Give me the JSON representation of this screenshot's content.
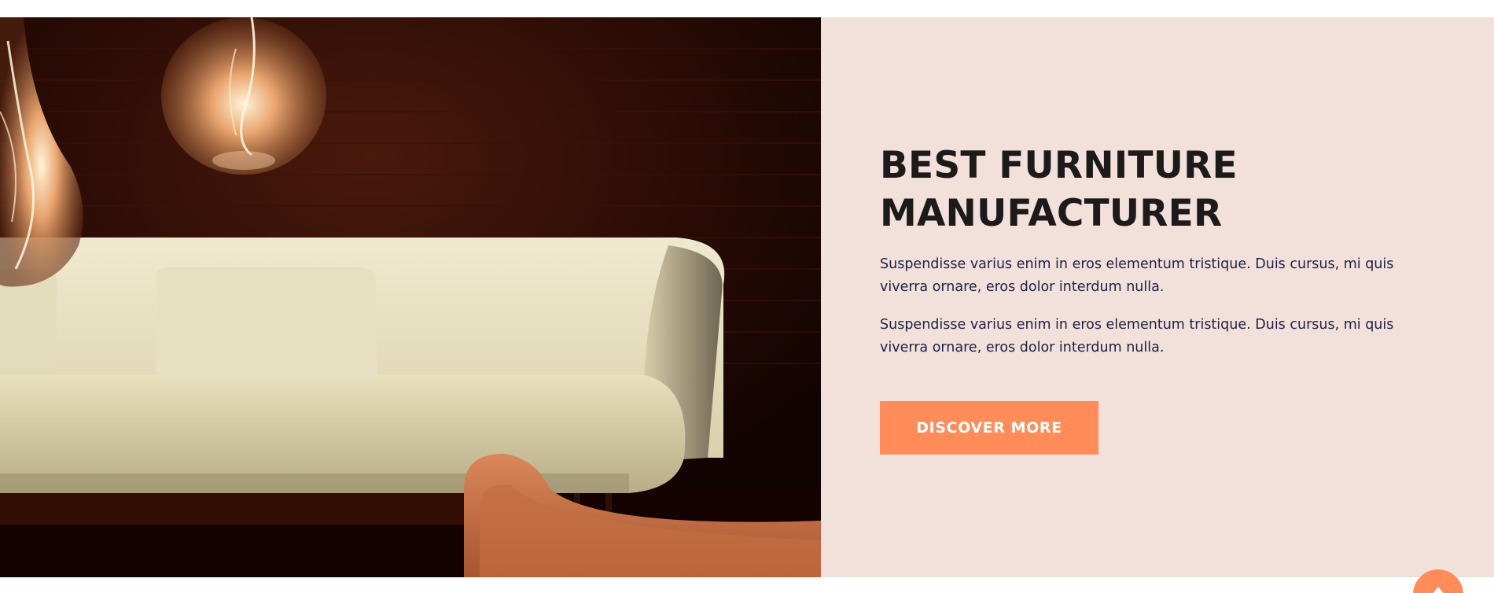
{
  "hero": {
    "image": {
      "description": "sofa-and-hanging-bulbs-photo"
    },
    "headline_line1": "BEST FURNITURE",
    "headline_line2": "MANUFACTURER",
    "paragraph1": "Suspendisse varius enim in eros elementum tristique. Duis cursus, mi quis viverra ornare, eros dolor interdum nulla.",
    "paragraph2": "Suspendisse varius enim in eros elementum tristique. Duis cursus, mi quis viverra ornare, eros dolor interdum nulla.",
    "cta_label": "DISCOVER MORE"
  },
  "scroll_top": {
    "icon": "chevron-up-icon"
  },
  "colors": {
    "accent": "#ff8c59",
    "panel_bg": "#f1e1da",
    "headline": "#1c1b1a",
    "body_text": "#1d2144"
  }
}
